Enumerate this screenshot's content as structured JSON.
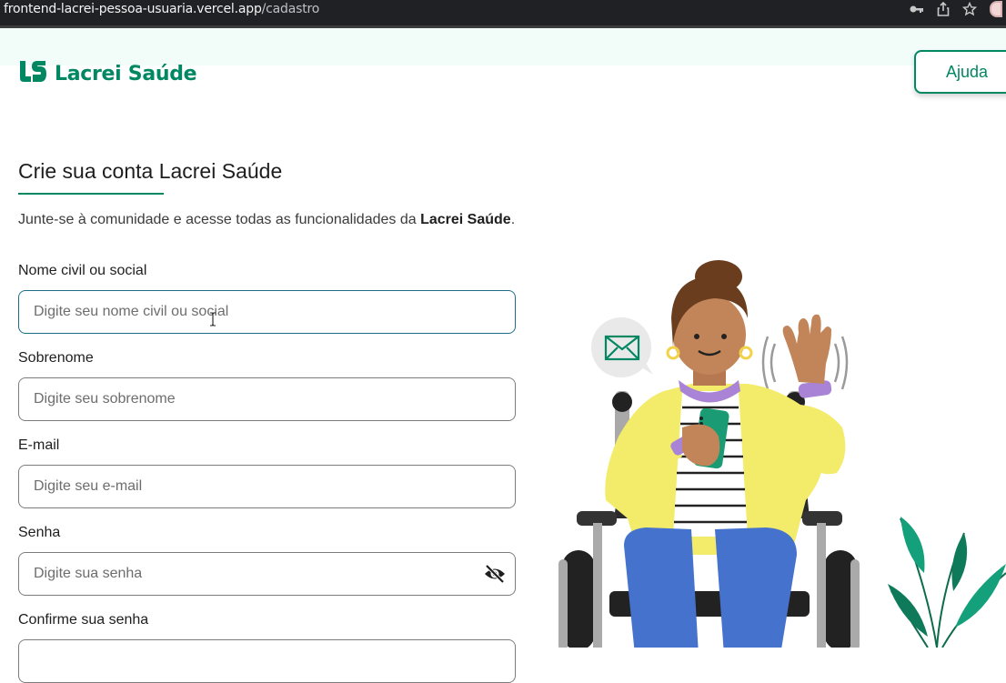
{
  "browser": {
    "url_host": "frontend-lacrei-pessoa-usuaria.vercel.app",
    "url_path": "/cadastro"
  },
  "header": {
    "logo_text": "Lacrei Saúde",
    "help_label": "Ajuda"
  },
  "page": {
    "title": "Crie sua conta Lacrei Saúde",
    "subtitle_prefix": "Junte-se à comunidade e acesse todas as funcionalidades da ",
    "subtitle_brand": "Lacrei Saúde",
    "subtitle_suffix": "."
  },
  "form": {
    "name": {
      "label": "Nome civil ou social",
      "placeholder": "Digite seu nome civil ou social",
      "value": ""
    },
    "surname": {
      "label": "Sobrenome",
      "placeholder": "Digite seu sobrenome",
      "value": ""
    },
    "email": {
      "label": "E-mail",
      "placeholder": "Digite seu e-mail",
      "value": ""
    },
    "password": {
      "label": "Senha",
      "placeholder": "Digite sua senha",
      "value": ""
    },
    "confirm_password": {
      "label": "Confirme sua senha",
      "placeholder": "",
      "value": ""
    }
  },
  "colors": {
    "brand": "#018762",
    "focus_border": "#1c6e89"
  }
}
